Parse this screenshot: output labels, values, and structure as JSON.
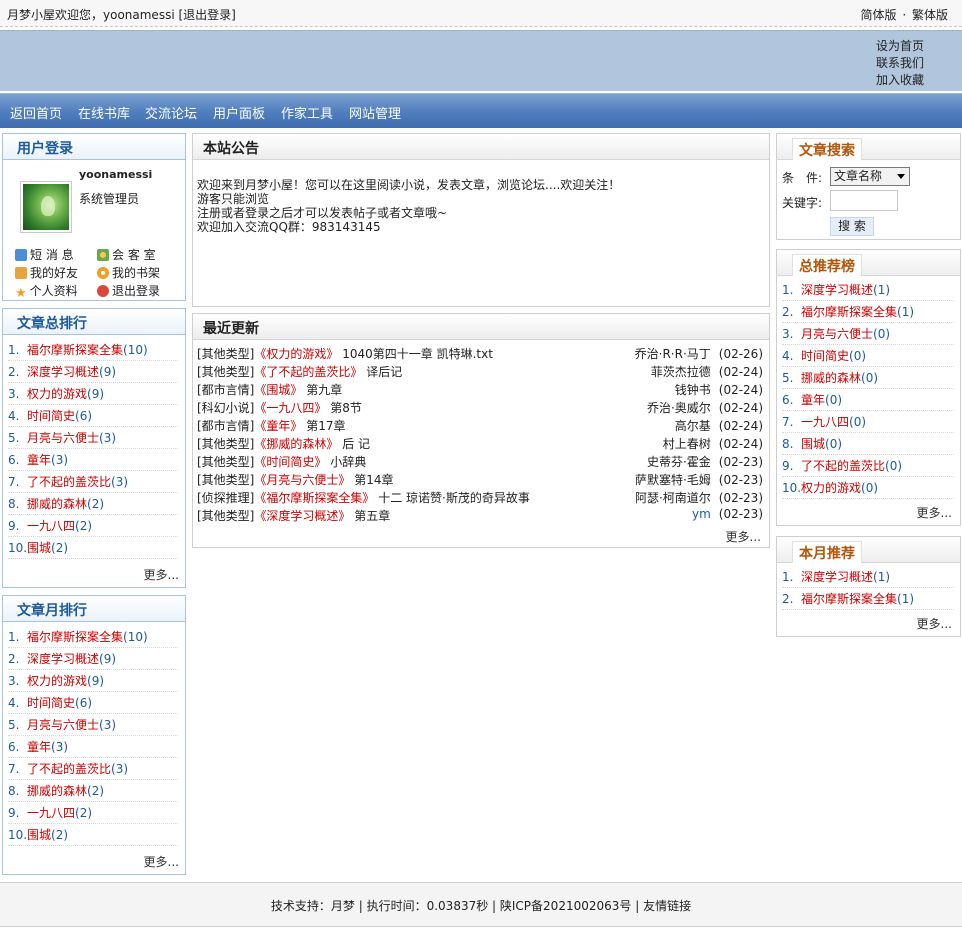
{
  "topbar": {
    "welcome": "月梦小屋欢迎您，yoonamessi [退出登录]",
    "simplified": "简体版",
    "sep": "·",
    "traditional": "繁体版"
  },
  "header_links": [
    "设为首页",
    "联系我们",
    "加入收藏"
  ],
  "nav": [
    "返回首页",
    "在线书库",
    "交流论坛",
    "用户面板",
    "作家工具",
    "网站管理"
  ],
  "login": {
    "title": "用户登录",
    "username": "yoonamessi",
    "role": "系统管理员",
    "links": [
      {
        "label": "短 消 息",
        "icon": "mail-icon"
      },
      {
        "label": "会 客 室",
        "icon": "people-icon"
      },
      {
        "label": "我的好友",
        "icon": "hand-icon"
      },
      {
        "label": "我的书架",
        "icon": "gear-icon"
      },
      {
        "label": "个人资料",
        "icon": "star-icon"
      },
      {
        "label": "退出登录",
        "icon": "logout-icon"
      }
    ]
  },
  "total_rank": {
    "title": "文章总排行",
    "more": "更多...",
    "items": [
      {
        "n": "1.",
        "title": "福尔摩斯探案全集",
        "count": "(10)"
      },
      {
        "n": "2.",
        "title": "深度学习概述",
        "count": "(9)"
      },
      {
        "n": "3.",
        "title": "权力的游戏",
        "count": "(9)"
      },
      {
        "n": "4.",
        "title": "时间简史",
        "count": "(6)"
      },
      {
        "n": "5.",
        "title": "月亮与六便士",
        "count": "(3)"
      },
      {
        "n": "6.",
        "title": "童年",
        "count": "(3)"
      },
      {
        "n": "7.",
        "title": "了不起的盖茨比",
        "count": "(3)"
      },
      {
        "n": "8.",
        "title": "挪威的森林",
        "count": "(2)"
      },
      {
        "n": "9.",
        "title": "一九八四",
        "count": "(2)"
      },
      {
        "n": "10.",
        "title": "围城",
        "count": "(2)"
      }
    ]
  },
  "month_rank": {
    "title": "文章月排行",
    "more": "更多...",
    "items": [
      {
        "n": "1.",
        "title": "福尔摩斯探案全集",
        "count": "(10)"
      },
      {
        "n": "2.",
        "title": "深度学习概述",
        "count": "(9)"
      },
      {
        "n": "3.",
        "title": "权力的游戏",
        "count": "(9)"
      },
      {
        "n": "4.",
        "title": "时间简史",
        "count": "(6)"
      },
      {
        "n": "5.",
        "title": "月亮与六便士",
        "count": "(3)"
      },
      {
        "n": "6.",
        "title": "童年",
        "count": "(3)"
      },
      {
        "n": "7.",
        "title": "了不起的盖茨比",
        "count": "(3)"
      },
      {
        "n": "8.",
        "title": "挪威的森林",
        "count": "(2)"
      },
      {
        "n": "9.",
        "title": "一九八四",
        "count": "(2)"
      },
      {
        "n": "10.",
        "title": "围城",
        "count": "(2)"
      }
    ]
  },
  "notice": {
    "title": "本站公告",
    "lines": [
      "欢迎来到月梦小屋！您可以在这里阅读小说，发表文章，浏览论坛....欢迎关注！",
      "游客只能浏览",
      "注册或者登录之后才可以发表帖子或者文章哦~",
      "欢迎加入交流QQ群：983143145"
    ]
  },
  "updates": {
    "title": "最近更新",
    "more": "更多...",
    "rows": [
      {
        "type": "[其他类型]",
        "book": "《权力的游戏》",
        "chapter": "1040第四十一章 凯特琳.txt",
        "author": "乔治·R·R·马丁",
        "date": "(02-26)"
      },
      {
        "type": "[其他类型]",
        "book": "《了不起的盖茨比》",
        "chapter": "译后记",
        "author": "菲茨杰拉德",
        "date": "(02-24)"
      },
      {
        "type": "[都市言情]",
        "book": "《围城》",
        "chapter": "第九章",
        "author": "钱钟书",
        "date": "(02-24)"
      },
      {
        "type": "[科幻小说]",
        "book": "《一九八四》",
        "chapter": "第8节",
        "author": "乔治·奥威尔",
        "date": "(02-24)"
      },
      {
        "type": "[都市言情]",
        "book": "《童年》",
        "chapter": "第17章",
        "author": "高尔基",
        "date": "(02-24)"
      },
      {
        "type": "[其他类型]",
        "book": "《挪威的森林》",
        "chapter": "后 记",
        "author": "村上春树",
        "date": "(02-24)"
      },
      {
        "type": "[其他类型]",
        "book": "《时间简史》",
        "chapter": "小辞典",
        "author": "史蒂芬·霍金",
        "date": "(02-23)"
      },
      {
        "type": "[其他类型]",
        "book": "《月亮与六便士》",
        "chapter": "第14章",
        "author": "萨默塞特·毛姆",
        "date": "(02-23)"
      },
      {
        "type": "[侦探推理]",
        "book": "《福尔摩斯探案全集》",
        "chapter": "十二 琼诺赞·斯茂的奇异故事",
        "author": "阿瑟·柯南道尔",
        "date": "(02-23)"
      },
      {
        "type": "[其他类型]",
        "book": "《深度学习概述》",
        "chapter": "第五章",
        "author": "ym",
        "date": "(02-23)"
      }
    ]
  },
  "search": {
    "title": "文章搜索",
    "cond_label": "条　件:",
    "cond_value": "文章名称",
    "keyword_label": "关键字:",
    "button": "搜 索"
  },
  "recommend": {
    "title": "总推荐榜",
    "more": "更多...",
    "items": [
      {
        "n": "1.",
        "title": "深度学习概述",
        "count": "(1)"
      },
      {
        "n": "2.",
        "title": "福尔摩斯探案全集",
        "count": "(1)"
      },
      {
        "n": "3.",
        "title": "月亮与六便士",
        "count": "(0)"
      },
      {
        "n": "4.",
        "title": "时间简史",
        "count": "(0)"
      },
      {
        "n": "5.",
        "title": "挪威的森林",
        "count": "(0)"
      },
      {
        "n": "6.",
        "title": "童年",
        "count": "(0)"
      },
      {
        "n": "7.",
        "title": "一九八四",
        "count": "(0)"
      },
      {
        "n": "8.",
        "title": "围城",
        "count": "(0)"
      },
      {
        "n": "9.",
        "title": "了不起的盖茨比",
        "count": "(0)"
      },
      {
        "n": "10.",
        "title": "权力的游戏",
        "count": "(0)"
      }
    ]
  },
  "month_recommend": {
    "title": "本月推荐",
    "more": "更多...",
    "items": [
      {
        "n": "1.",
        "title": "深度学习概述",
        "count": "(1)"
      },
      {
        "n": "2.",
        "title": "福尔摩斯探案全集",
        "count": "(1)"
      }
    ]
  },
  "footer": {
    "text": "技术支持：月梦 | 执行时间：0.03837秒 | 陕ICP备2021002063号 | 友情链接"
  }
}
